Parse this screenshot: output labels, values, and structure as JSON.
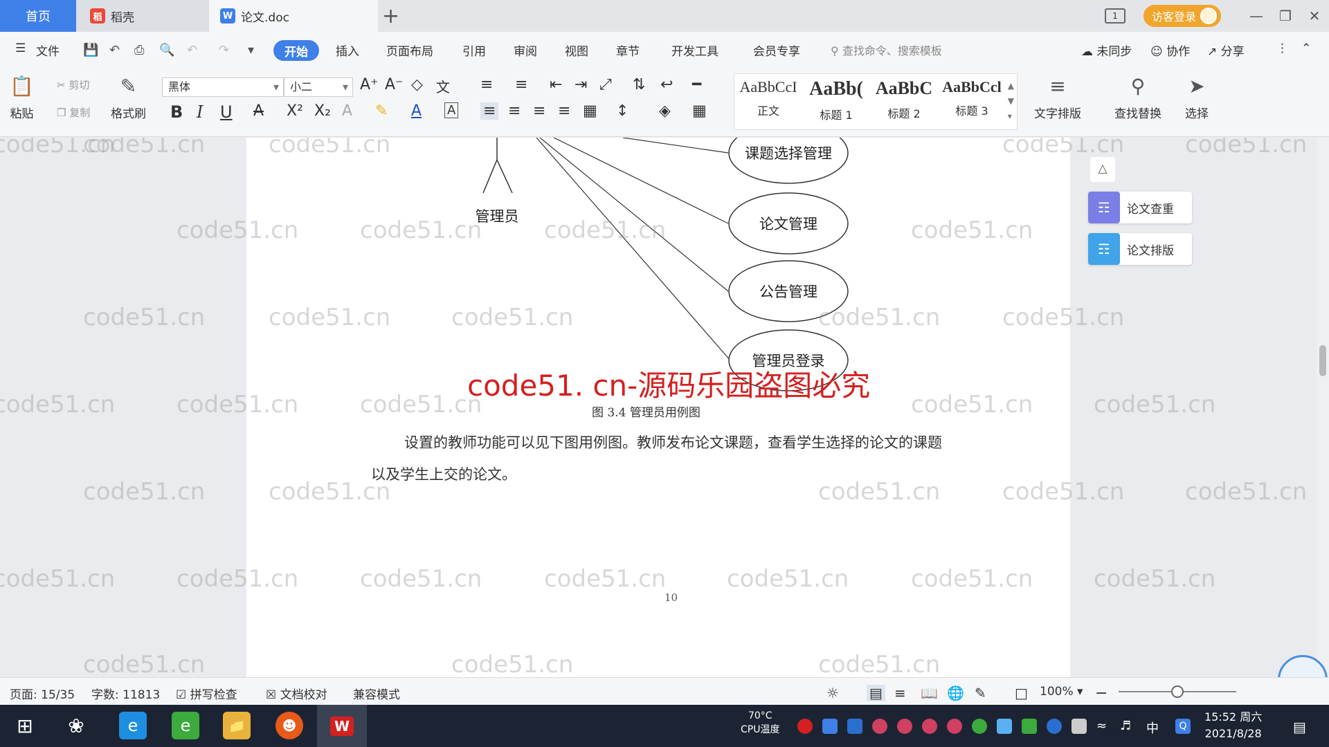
{
  "tabs": {
    "home": "首页",
    "wps": "稻壳",
    "doc": "论文.doc",
    "new_tab": "+"
  },
  "title_bar": {
    "guest_login": "访客登录",
    "page_indicator": "1"
  },
  "menu": {
    "file": "文件",
    "items": [
      "开始",
      "插入",
      "页面布局",
      "引用",
      "审阅",
      "视图",
      "章节",
      "开发工具",
      "会员专享"
    ],
    "search_placeholder": "查找命令、搜索模板",
    "unsynced": "未同步",
    "collaborate": "协作",
    "share": "分享"
  },
  "ribbon": {
    "paste": "粘贴",
    "cut": "剪切",
    "copy": "复制",
    "format_painter": "格式刷",
    "font_name": "黑体",
    "font_size": "小二",
    "styles": [
      {
        "preview": "AaBbCcI",
        "name": "正文"
      },
      {
        "preview": "AaBb(",
        "name": "标题 1"
      },
      {
        "preview": "AaBbC",
        "name": "标题 2"
      },
      {
        "preview": "AaBbCcl",
        "name": "标题 3"
      }
    ],
    "text_layout": "文字排版",
    "find_replace": "查找替换",
    "select": "选择"
  },
  "document": {
    "actor": "管理员",
    "use_cases": [
      "课题选择管理",
      "论文管理",
      "公告管理",
      "管理员登录"
    ],
    "red_watermark": "code51. cn-源码乐园盗图必究",
    "watermark_text": "code51.cn",
    "caption": "图 3.4  管理员用例图",
    "paragraph": "设置的教师功能可以见下图用例图。教师发布论文课题，查看学生选择的论文的课题以及学生上交的论文。",
    "page_number": "10"
  },
  "side_panel": {
    "check": "论文查重",
    "layout": "论文排版"
  },
  "status": {
    "page": "页面: 15/35",
    "words": "字数: 11813",
    "spell": "拼写检查",
    "proof": "文档校对",
    "compat": "兼容模式",
    "zoom": "100%",
    "zoom_level": 0.5
  },
  "taskbar": {
    "cpu_temp": "70°C",
    "cpu_label": "CPU温度",
    "ime": "中",
    "time": "15:52 周六",
    "date": "2021/8/28"
  },
  "colors": {
    "accent": "#3f7fe8",
    "guest": "#f0a52d",
    "watermark_red": "#d42020",
    "taskbar": "#1c2433"
  }
}
